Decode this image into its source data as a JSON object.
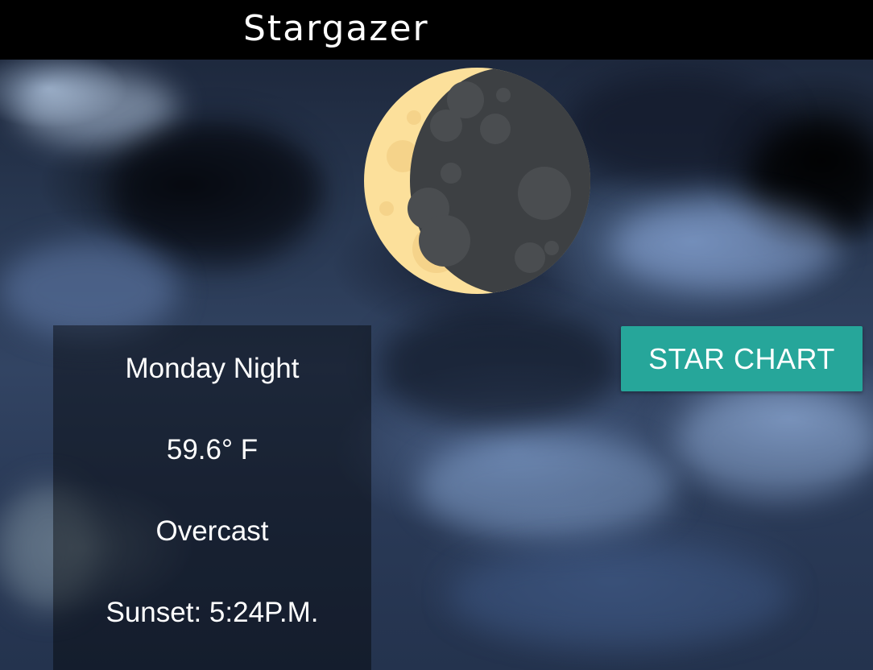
{
  "header": {
    "title": "Stargazer"
  },
  "moon": {
    "icon": "waning-crescent-moon-icon",
    "lit_color": "#fce09b",
    "dark_color": "#3d4043"
  },
  "forecast": {
    "day": "Monday Night",
    "temperature": "59.6° F",
    "condition": "Overcast",
    "sunset": "Sunset: 5:24P.M."
  },
  "actions": {
    "star_chart_label": "STAR CHART"
  },
  "colors": {
    "header_bg": "#000000",
    "button_accent": "#26a69a"
  }
}
